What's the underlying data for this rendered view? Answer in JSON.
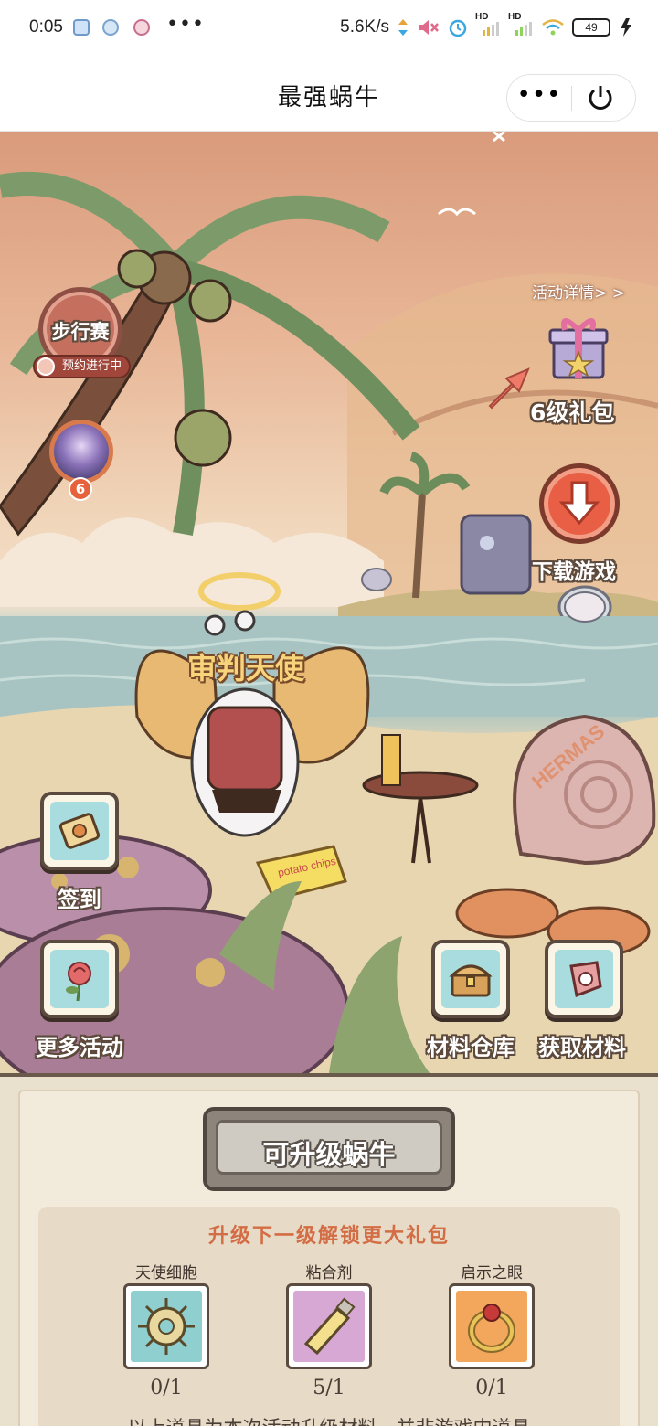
{
  "status_bar": {
    "time": "0:05",
    "net_speed": "5.6K/s",
    "signal_1": "HD",
    "signal_2": "HD",
    "battery": "49",
    "more": "•••"
  },
  "title_bar": {
    "title": "最强蜗牛",
    "more_label": "•••"
  },
  "scene": {
    "race": {
      "label": "步行赛",
      "badge": "预约进行中"
    },
    "avatar_level": "6",
    "activity_link": "活动详情> >",
    "gift_label": "6级礼包",
    "download_label": "下载游戏",
    "character_name": "审判天使",
    "buttons": {
      "sign_in": "签到",
      "more_events": "更多活动",
      "warehouse": "材料仓库",
      "get_materials": "获取材料"
    },
    "props": {
      "chips_text": "potato chips",
      "shell_text": "HERMAS"
    }
  },
  "panel": {
    "upgrade_button": "可升级蜗牛",
    "heading": "升级下一级解锁更大礼包",
    "materials": [
      {
        "name": "天使细胞",
        "count": "0/1",
        "color": "#8fcfcf"
      },
      {
        "name": "粘合剂",
        "count": "5/1",
        "color": "#d8a8d4"
      },
      {
        "name": "启示之眼",
        "count": "0/1",
        "color": "#f2a75c"
      }
    ],
    "footnote": "以上道具为本次活动升级材料，并非游戏内道具"
  },
  "colors": {
    "accent_red": "#e85f45",
    "heading_orange": "#d36d45",
    "panel_bg": "#eae0ce"
  }
}
